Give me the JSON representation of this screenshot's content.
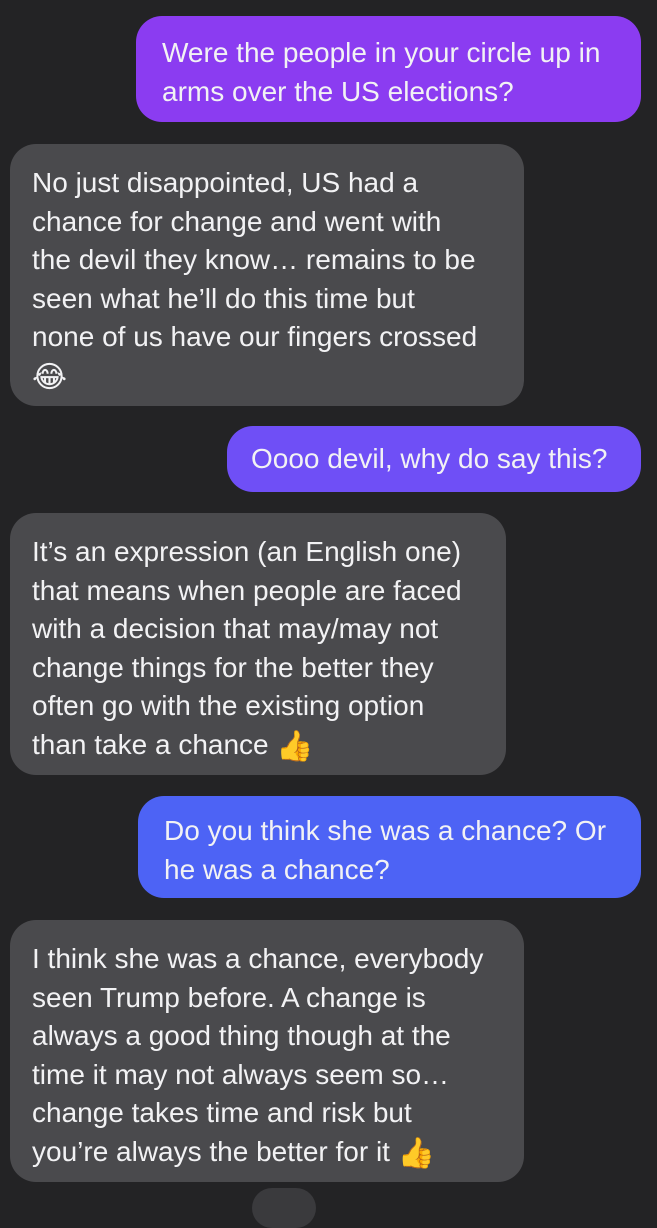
{
  "conversation": {
    "messages": [
      {
        "direction": "sent",
        "text": "Were the people in your circle up in\narms over the US elections?",
        "emoji": ""
      },
      {
        "direction": "received",
        "text": "No just disappointed, US had a\nchance for change and went with\nthe devil they know… remains to be\nseen what he’ll do this time but\nnone of us have our fingers crossed\n",
        "emoji": "😂"
      },
      {
        "direction": "sent",
        "text": "Oooo devil, why do say this?",
        "emoji": ""
      },
      {
        "direction": "received",
        "text": "It’s an expression (an English one)\nthat means when people are faced\nwith a decision that may/may not\nchange things for the better they\noften go with the existing option\nthan take a chance ",
        "emoji": "👍"
      },
      {
        "direction": "sent",
        "text": "Do you think she was a chance? Or\nhe was a chance?",
        "emoji": ""
      },
      {
        "direction": "received",
        "text": "I think she was a chance, everybody\nseen Trump before. A change is\nalways a good thing though at the\ntime it may not always seem so…\nchange takes time and risk but\nyou’re always the better for it ",
        "emoji": "👍"
      }
    ]
  },
  "colors": {
    "background": "#232325",
    "received_bubble": "#4a4a4d",
    "sent_gradient_top": "#8b3cf1",
    "sent_gradient_mid": "#6f4ff6",
    "sent_gradient_bottom": "#4d63f5",
    "text": "#f2f2f4"
  }
}
